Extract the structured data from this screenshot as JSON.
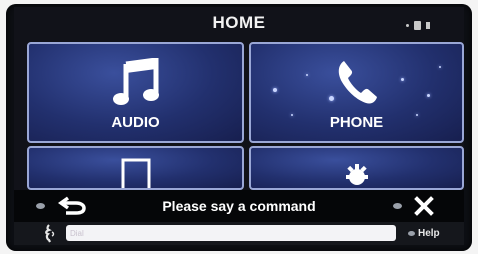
{
  "header": {
    "title": "HOME"
  },
  "tiles": [
    {
      "label": "AUDIO",
      "icon": "music-note-icon"
    },
    {
      "label": "PHONE",
      "icon": "phone-handset-icon"
    },
    {
      "label": "",
      "icon": "navigation-square-icon"
    },
    {
      "label": "",
      "icon": "settings-gear-icon"
    }
  ],
  "voice": {
    "prompt": "Please say a command",
    "input_placeholder": "Dial",
    "help_label": "Help"
  },
  "colors": {
    "tile_blue": "#22306e",
    "tile_border": "#9aa7d6",
    "bar_black": "#050608"
  }
}
